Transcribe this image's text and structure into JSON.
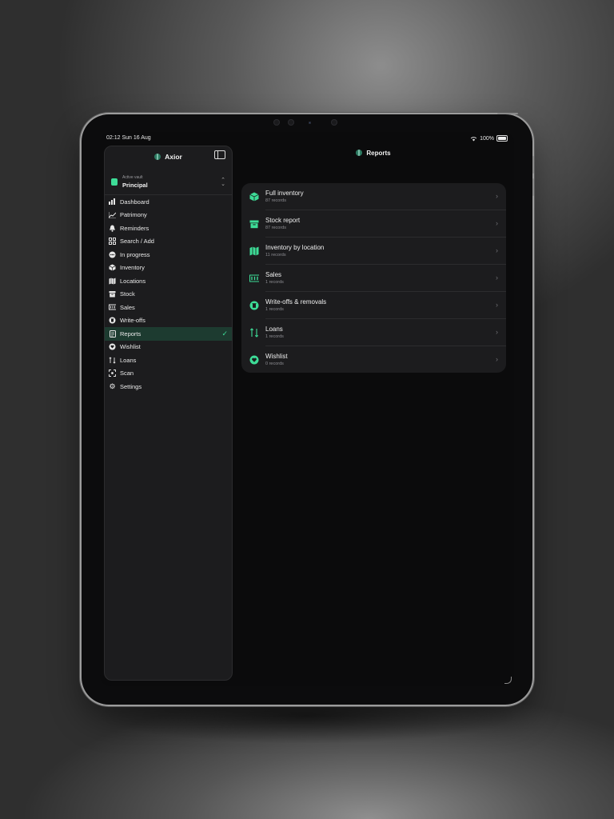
{
  "status_bar": {
    "time_date": "02:12  Sun 16 Aug",
    "battery": "100%"
  },
  "sidebar": {
    "app_title": "Axior",
    "vault_label": "Active vault",
    "vault_name": "Principal",
    "items": [
      {
        "label": "Dashboard",
        "icon": "bar-chart-icon"
      },
      {
        "label": "Patrimony",
        "icon": "line-chart-icon"
      },
      {
        "label": "Reminders",
        "icon": "bell-icon"
      },
      {
        "label": "Search / Add",
        "icon": "grid-icon"
      },
      {
        "label": "In progress",
        "icon": "ellipsis-circle-icon"
      },
      {
        "label": "Inventory",
        "icon": "cube-icon"
      },
      {
        "label": "Locations",
        "icon": "map-icon"
      },
      {
        "label": "Stock",
        "icon": "archive-box-icon"
      },
      {
        "label": "Sales",
        "icon": "banknote-icon"
      },
      {
        "label": "Write-offs",
        "icon": "trash-circle-icon"
      },
      {
        "label": "Reports",
        "icon": "document-icon",
        "selected": true
      },
      {
        "label": "Wishlist",
        "icon": "heart-circle-icon"
      },
      {
        "label": "Loans",
        "icon": "arrows-icon"
      },
      {
        "label": "Scan",
        "icon": "viewfinder-icon"
      },
      {
        "label": "Settings",
        "icon": "gear-icon"
      }
    ]
  },
  "main": {
    "title": "Reports",
    "reports": [
      {
        "title": "Full inventory",
        "subtitle": "87 records",
        "icon": "cube-icon"
      },
      {
        "title": "Stock report",
        "subtitle": "87 records",
        "icon": "archive-box-icon"
      },
      {
        "title": "Inventory by location",
        "subtitle": "11 records",
        "icon": "map-icon"
      },
      {
        "title": "Sales",
        "subtitle": "1 records",
        "icon": "banknote-icon"
      },
      {
        "title": "Write-offs & removals",
        "subtitle": "1 records",
        "icon": "trash-circle-icon"
      },
      {
        "title": "Loans",
        "subtitle": "1 records",
        "icon": "arrows-icon"
      },
      {
        "title": "Wishlist",
        "subtitle": "0 records",
        "icon": "heart-circle-icon"
      }
    ]
  },
  "colors": {
    "accent": "#3ddc97",
    "background": "#0b0b0c",
    "card": "#1c1c1e",
    "selected_row": "#1d3b30"
  }
}
